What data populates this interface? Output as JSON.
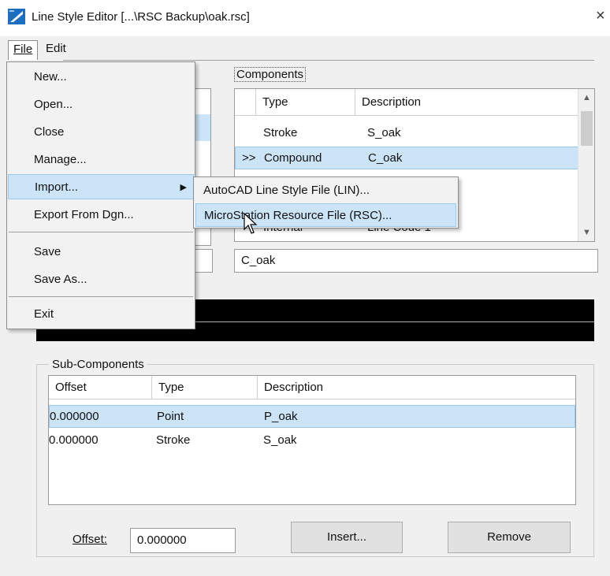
{
  "window": {
    "title": "Line Style Editor [...\\RSC Backup\\oak.rsc]",
    "close_glyph": "×"
  },
  "menubar": {
    "file": "File",
    "edit": "Edit"
  },
  "file_menu": {
    "items": [
      "New...",
      "Open...",
      "Close",
      "Manage...",
      "Import...",
      "Export From Dgn...",
      "Save",
      "Save As...",
      "Exit"
    ],
    "highlighted": "Import..."
  },
  "import_submenu": {
    "items": [
      "AutoCAD Line Style File (LIN)...",
      "MicroStation Resource File (RSC)..."
    ],
    "highlighted": "MicroStation Resource File (RSC)..."
  },
  "components": {
    "label": "Components",
    "columns": [
      "Type",
      "Description"
    ],
    "rows": [
      {
        "marker": "",
        "type": "Stroke",
        "description": "S_oak"
      },
      {
        "marker": ">>",
        "type": "Compound",
        "description": "C_oak",
        "selected": true
      },
      {
        "marker": "",
        "type": "Internal",
        "description": "Line Code 1"
      }
    ],
    "name_value": "C_oak"
  },
  "sub_components": {
    "label": "Sub-Components",
    "columns": [
      "Offset",
      "Type",
      "Description"
    ],
    "rows": [
      {
        "offset": "0.000000",
        "type": "Point",
        "description": "P_oak",
        "selected": true
      },
      {
        "offset": "0.000000",
        "type": "Stroke",
        "description": "S_oak"
      }
    ],
    "offset_label": "Offset:",
    "offset_value": "0.000000",
    "insert_label": "Insert...",
    "remove_label": "Remove"
  },
  "colors": {
    "selection": "#cce4f7",
    "selection_border": "#99c9ef",
    "preview_bg": "#000000",
    "icon_blue": "#1a6fc4"
  }
}
